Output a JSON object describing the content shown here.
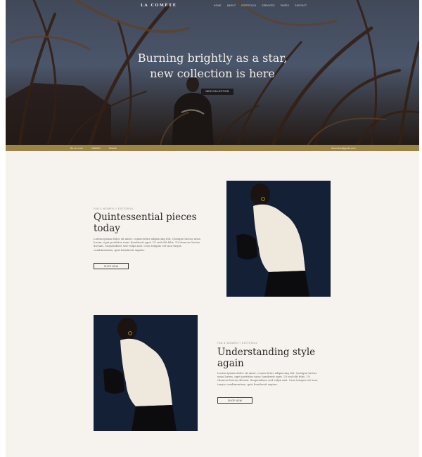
{
  "nav": {
    "logo": "LA COMÈTE",
    "items": [
      "HOME",
      "ABOUT",
      "PORTFOLIO",
      "SERVICES",
      "PAGES",
      "CONTACT"
    ]
  },
  "hero": {
    "title_line1": "Burning brightly as a star,",
    "title_line2": "new collection is here",
    "button": "NEW COLLECTION"
  },
  "strip": {
    "links": [
      "Be-cnr.com",
      "Wishlist",
      "Search"
    ],
    "email": "lacomete@gmail.com"
  },
  "section1": {
    "kicker": "FAB & WOMEN // EDITORIAL",
    "title_line1": "Quintessential pieces",
    "title_line2": "today",
    "para_lines": [
      "Lorem ipsum dolor sit amet, consectetur adipiscing elit. Quisque luctus urna",
      "lorem, eget porttitor nunc hendrerit eget. Ut sed elit felis. Ut rhoncus luctus",
      "dictum. Suspendisse sed vulpa nisi. Cras tempus est non turpis",
      "condimentum, quis hendrerit sapien."
    ],
    "button": "SHOP NOW"
  },
  "section2": {
    "kicker": "FAB & WOMEN // EDITORIAL",
    "title_line1": "Understanding style",
    "title_line2": "again",
    "para_lines": [
      "Lorem ipsum dolor sit amet, consectetur adipiscing elit. Quisque luctus",
      "urna lorem, eget porttitor nunc hendrerit eget. Ut sed elit felis. Ut",
      "rhoncus luctus dictum. Suspendisse sed vulpa nisi. Cras tempus est non",
      "turpis condimentum, quis hendrerit sapien."
    ],
    "button": "SHOP NOW"
  },
  "colors": {
    "accent_strip": "#9c8346",
    "background": "#f6f3ef",
    "heading": "#2a2826"
  }
}
